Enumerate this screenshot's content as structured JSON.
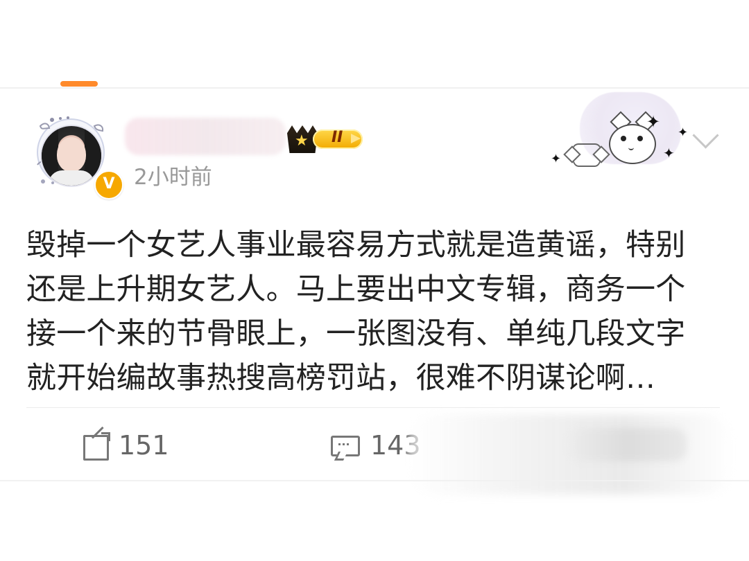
{
  "post": {
    "timestamp": "2小时前",
    "vip_level": "II",
    "verified_label": "V",
    "text_lines": [
      "毁掉一个女艺人事业最容易方式就是造黄谣，特别",
      "还是上升期女艺人。马上要出中文专辑，商务一个",
      "接一个来的节骨眼上，一张图没有、单纯几段文字",
      "就开始编故事热搜高榜罚站，很难不阴谋论啊…"
    ]
  },
  "actions": {
    "share_count": "151",
    "comment_count": "143"
  },
  "icons": {
    "share": "share-icon",
    "comment": "comment-icon",
    "more": "chevron-down-icon",
    "vip": "crown-icon"
  },
  "colors": {
    "accent": "#ff8a2b",
    "timestamp": "#999999",
    "text": "#222222",
    "vip_gold": "#f2aa00",
    "verified": "#f6a800"
  }
}
